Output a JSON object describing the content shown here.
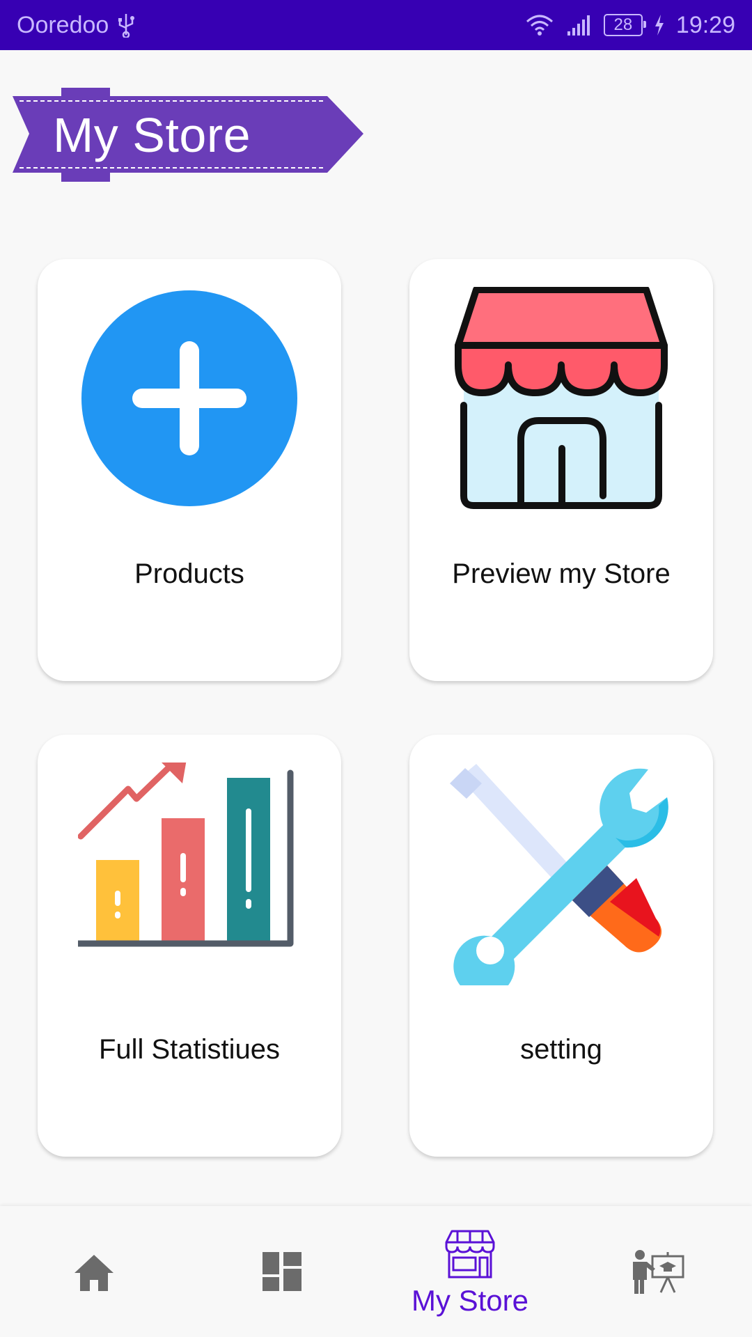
{
  "status_bar": {
    "carrier": "Ooredoo",
    "battery": "28",
    "time": "19:29"
  },
  "header": {
    "title": "My Store"
  },
  "cards": [
    {
      "label": "Products",
      "icon": "add-circle-icon"
    },
    {
      "label": "Preview my Store",
      "icon": "store-icon"
    },
    {
      "label": "Full Statistiues",
      "icon": "bar-chart-icon"
    },
    {
      "label": "setting",
      "icon": "tools-icon"
    }
  ],
  "bottom_nav": {
    "items": [
      {
        "icon": "home-icon",
        "active": false
      },
      {
        "icon": "dashboard-icon",
        "active": false
      },
      {
        "icon": "store-icon",
        "label": "My Store",
        "active": true
      },
      {
        "icon": "teacher-icon",
        "active": false
      }
    ]
  },
  "colors": {
    "status_bar": "#3700b3",
    "banner": "#6a3db8",
    "accent": "#5a11d6",
    "plus_circle": "#2196f3",
    "nav_inactive": "#6b6b6b"
  }
}
